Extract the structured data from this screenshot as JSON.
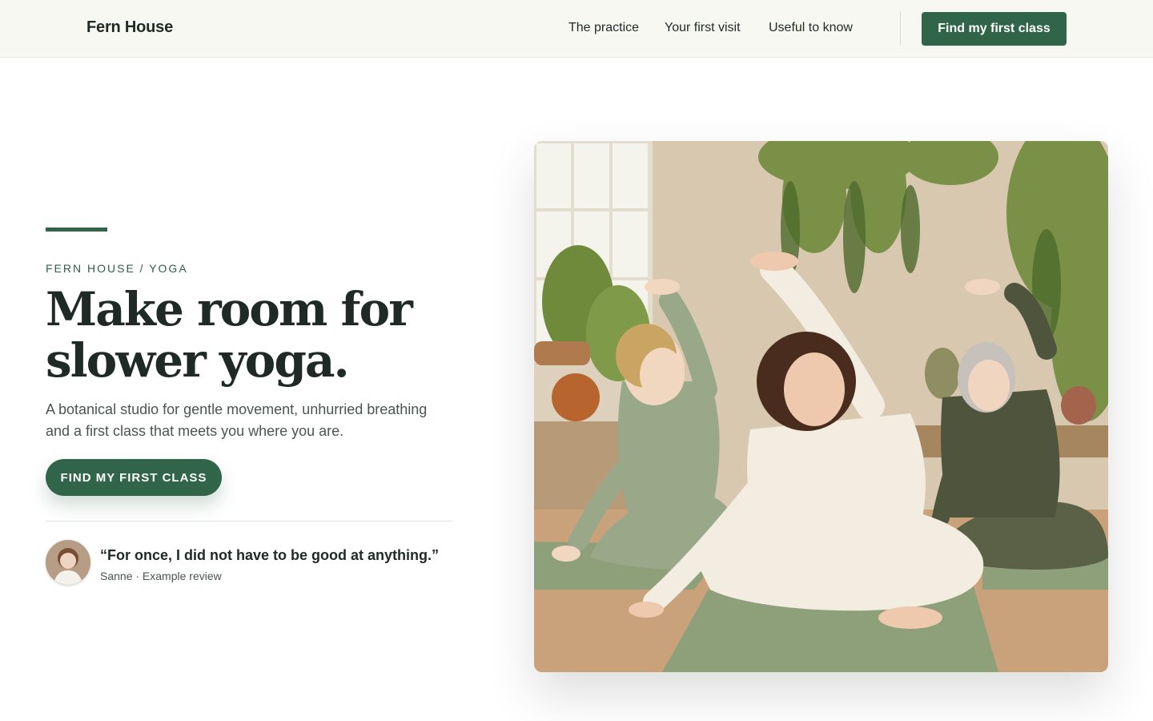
{
  "header": {
    "brand": "Fern House",
    "nav": [
      "The practice",
      "Your first visit",
      "Useful to know"
    ],
    "cta_label": "Find my first class"
  },
  "hero": {
    "eyebrow": "FERN HOUSE / YOGA",
    "headline": "Make room for slower yoga.",
    "lede": "A botanical studio for gentle movement, unhurried breathing and a first class that meets you where you are.",
    "cta_label": "FIND MY FIRST CLASS",
    "review": {
      "quote": "“For once, I did not have to be good at anything.”",
      "attribution": "Sanne · Example review"
    }
  },
  "colors": {
    "brand_green": "#306549",
    "header_bg": "#f8f8f3",
    "text_dark": "#1f2a26"
  },
  "icons": {
    "review_avatar": "person-avatar"
  }
}
